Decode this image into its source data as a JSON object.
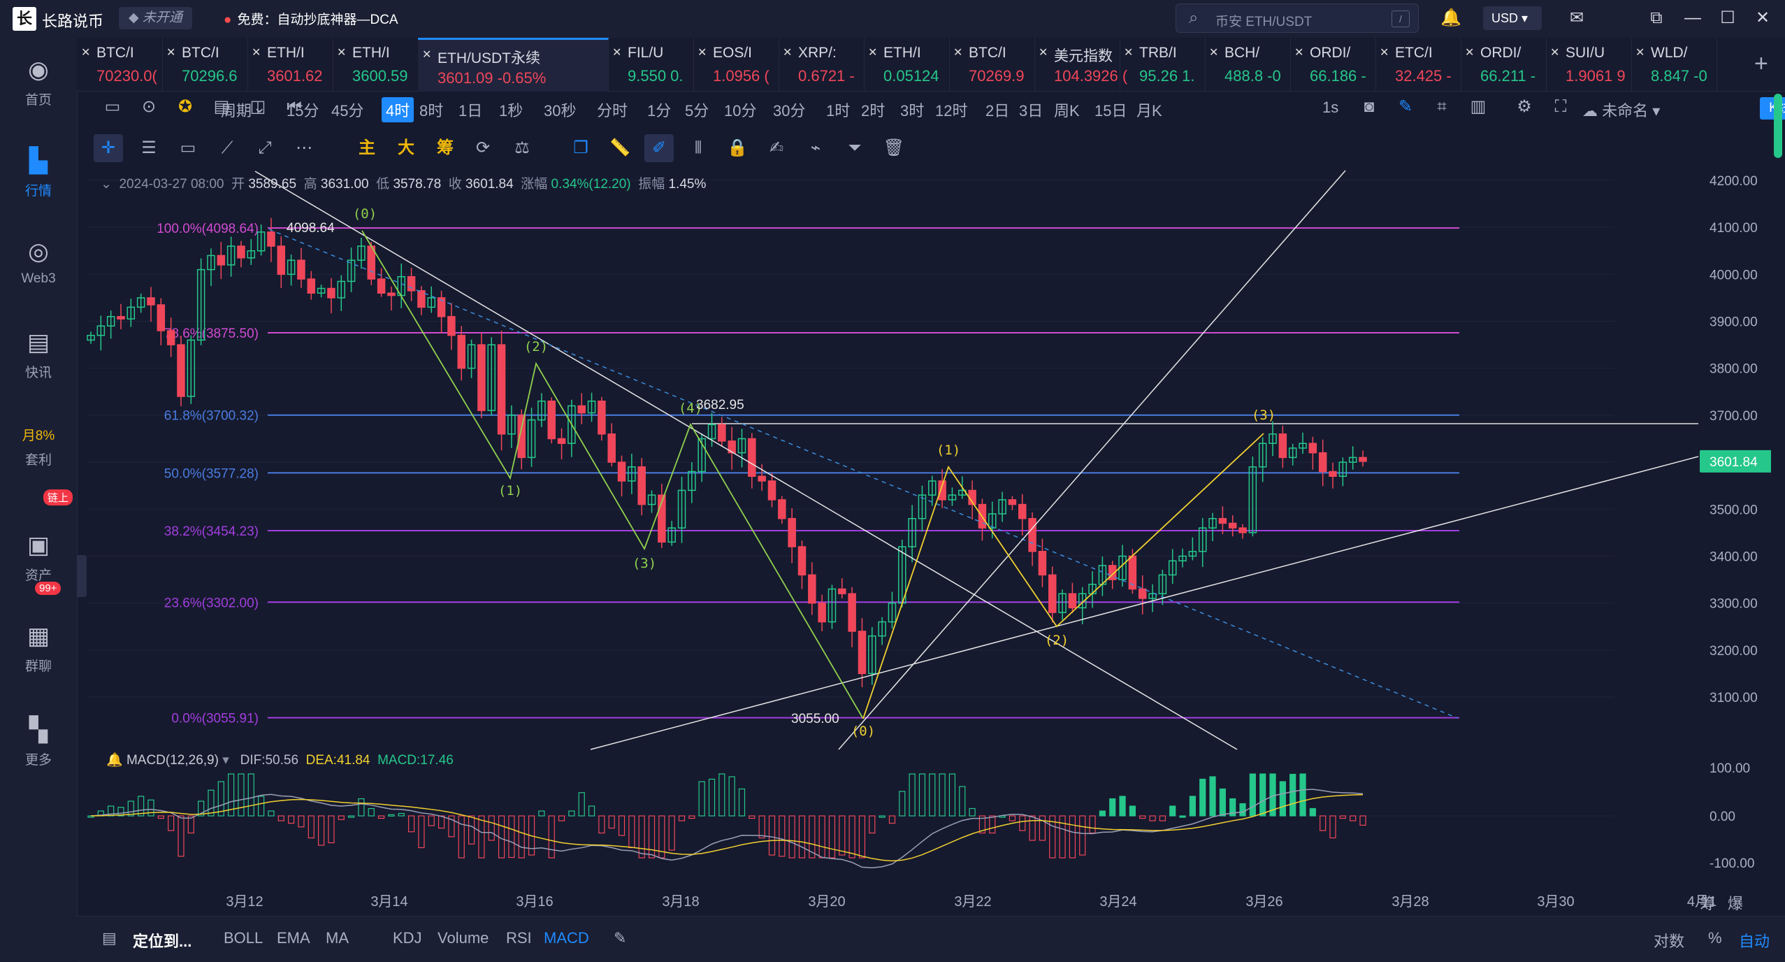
{
  "app": {
    "name": "长路说币",
    "status": "未开通",
    "promo": "免费：自动抄底神器—DCA"
  },
  "search": {
    "placeholder": "币安 ETH/USDT",
    "shortcut": "/"
  },
  "currency": "USD",
  "sidebar": [
    {
      "label": "首页",
      "icon": "home-icon"
    },
    {
      "label": "行情",
      "icon": "market-icon",
      "active": true
    },
    {
      "label": "Web3",
      "icon": "web3-icon"
    },
    {
      "label": "快讯",
      "icon": "news-icon"
    },
    {
      "label": "月8%",
      "label2": "套利",
      "icon": "arbitrage-icon"
    },
    {
      "label": "资产",
      "icon": "wallet-icon",
      "badge": "链上"
    },
    {
      "label": "群聊",
      "icon": "chat-icon",
      "badge": "99+"
    },
    {
      "label": "更多",
      "icon": "more-icon"
    }
  ],
  "tickers": [
    {
      "name": "BTC/I",
      "price": "70230.0(",
      "dir": "dn"
    },
    {
      "name": "BTC/I",
      "price": "70296.6",
      "dir": "up"
    },
    {
      "name": "ETH/I",
      "price": "3601.62",
      "dir": "dn"
    },
    {
      "name": "ETH/I",
      "price": "3600.59",
      "dir": "up"
    },
    {
      "name": "ETH/USDT永续",
      "price": "3601.09  -0.65%",
      "dir": "dn",
      "active": true
    },
    {
      "name": "FIL/U",
      "price": "9.550  0.",
      "dir": "up"
    },
    {
      "name": "EOS/I",
      "price": "1.0956  (",
      "dir": "dn"
    },
    {
      "name": "XRP/:",
      "price": "0.6721  -",
      "dir": "dn"
    },
    {
      "name": "ETH/I",
      "price": "0.05124",
      "dir": "up"
    },
    {
      "name": "BTC/I",
      "price": "70269.9",
      "dir": "dn"
    },
    {
      "name": "美元指数",
      "price": "104.3926  (",
      "dir": "dn"
    },
    {
      "name": "TRB/I",
      "price": "95.26  1.",
      "dir": "up"
    },
    {
      "name": "BCH/",
      "price": "488.8  -0",
      "dir": "up"
    },
    {
      "name": "ORDI/",
      "price": "66.186  -",
      "dir": "up"
    },
    {
      "name": "ETC/I",
      "price": "32.425  -",
      "dir": "dn"
    },
    {
      "name": "ORDI/",
      "price": "66.211  -",
      "dir": "up"
    },
    {
      "name": "SUI/U",
      "price": "1.9061  9",
      "dir": "dn"
    },
    {
      "name": "WLD/",
      "price": "8.847  -0",
      "dir": "up"
    }
  ],
  "periods": [
    "周期",
    "15分",
    "45分",
    "4时",
    "8时",
    "1日",
    "1秒",
    "30秒",
    "分时",
    "1分",
    "5分",
    "10分",
    "30分",
    "1时",
    "2时",
    "3时",
    "12时",
    "2日",
    "3日",
    "周K",
    "15日",
    "月K"
  ],
  "active_period": "4时",
  "period_right": {
    "interval": "1s",
    "layout_name": "未命名",
    "analysis": "K线分析"
  },
  "draw_tools": {
    "main": "主",
    "big": "大",
    "chip": "筹"
  },
  "info": {
    "date": "2024-03-27 08:00",
    "open_label": "开",
    "open": "3589.65",
    "high_label": "高",
    "high": "3631.00",
    "low_label": "低",
    "low": "3578.78",
    "close_label": "收",
    "close": "3601.84",
    "chg_label": "涨幅",
    "chg": "0.34%(12.20)",
    "amp_label": "振幅",
    "amp": "1.45%"
  },
  "chart_data": {
    "type": "candlestick",
    "symbol": "ETH/USDT永续",
    "interval": "4时",
    "y_ticks": [
      "4200.00",
      "4100.00",
      "4000.00",
      "3900.00",
      "3800.00",
      "3700.00",
      "3600.00",
      "3500.00",
      "3400.00",
      "3300.00",
      "3200.00",
      "3100.00"
    ],
    "y_range": [
      3040,
      4240
    ],
    "last_price": "3601.84",
    "x_labels": [
      "3月12",
      "3月14",
      "3月16",
      "3月18",
      "3月20",
      "3月22",
      "3月24",
      "3月26",
      "3月28",
      "3月30",
      "4月1"
    ],
    "fib_levels": [
      {
        "label": "100.0%(4098.64)",
        "value": 4098.64,
        "color": "#d14bd1"
      },
      {
        "label": "78.6%(3875.50)",
        "value": 3875.5,
        "color": "#d14bd1"
      },
      {
        "label": "61.8%(3700.32)",
        "value": 3700.32,
        "color": "#4a7ce0"
      },
      {
        "label": "50.0%(3577.28)",
        "value": 3577.28,
        "color": "#4a7ce0"
      },
      {
        "label": "38.2%(3454.23)",
        "value": 3454.23,
        "color": "#a23ee0"
      },
      {
        "label": "23.6%(3302.00)",
        "value": 3302.0,
        "color": "#a23ee0"
      },
      {
        "label": "0.0%(3055.91)",
        "value": 3055.91,
        "color": "#a23ee0"
      }
    ],
    "annotations": {
      "high": "4098.64",
      "low": "3055.00",
      "mid": "3682.95"
    },
    "wave_labels": [
      "(0)",
      "(1)",
      "(2)",
      "(3)",
      "(4)",
      "(0)",
      "(1)",
      "(2)",
      "(3)"
    ],
    "closes": [
      3870,
      3890,
      3910,
      3905,
      3930,
      3950,
      3935,
      3880,
      3850,
      3740,
      3860,
      4010,
      4040,
      4020,
      4060,
      4035,
      4050,
      4090,
      4060,
      4000,
      4030,
      3990,
      3960,
      3970,
      3950,
      3985,
      4030,
      4060,
      3990,
      3960,
      3955,
      3995,
      3965,
      3930,
      3950,
      3910,
      3870,
      3800,
      3850,
      3710,
      3850,
      3660,
      3700,
      3610,
      3690,
      3730,
      3650,
      3640,
      3720,
      3705,
      3730,
      3660,
      3600,
      3560,
      3590,
      3510,
      3530,
      3430,
      3460,
      3540,
      3580,
      3650,
      3680,
      3645,
      3620,
      3650,
      3570,
      3560,
      3520,
      3480,
      3420,
      3360,
      3300,
      3260,
      3330,
      3320,
      3240,
      3150,
      3230,
      3260,
      3300,
      3420,
      3480,
      3530,
      3560,
      3520,
      3530,
      3540,
      3510,
      3460,
      3490,
      3520,
      3510,
      3480,
      3410,
      3360,
      3280,
      3320,
      3290,
      3320,
      3340,
      3380,
      3350,
      3400,
      3330,
      3310,
      3320,
      3360,
      3390,
      3400,
      3410,
      3460,
      3480,
      3470,
      3460,
      3450,
      3590,
      3640,
      3660,
      3610,
      3630,
      3640,
      3620,
      3580,
      3570,
      3600,
      3610,
      3601.84
    ],
    "macd": {
      "label": "MACD(12,26,9)",
      "dif_label": "DIF:50.56",
      "dea_label": "DEA:41.84",
      "macd_label": "MACD:17.46",
      "y_ticks": [
        "100.00",
        "0.00",
        "-100.00"
      ]
    }
  },
  "bottom": {
    "locate": "定位到...",
    "indicators_main": [
      "BOLL",
      "EMA",
      "MA"
    ],
    "indicators_sub": [
      "KDJ",
      "Volume",
      "RSI",
      "MACD"
    ],
    "active": "MACD",
    "right": [
      "对数",
      "%",
      "自动"
    ],
    "corner": [
      "筹",
      "爆"
    ]
  }
}
